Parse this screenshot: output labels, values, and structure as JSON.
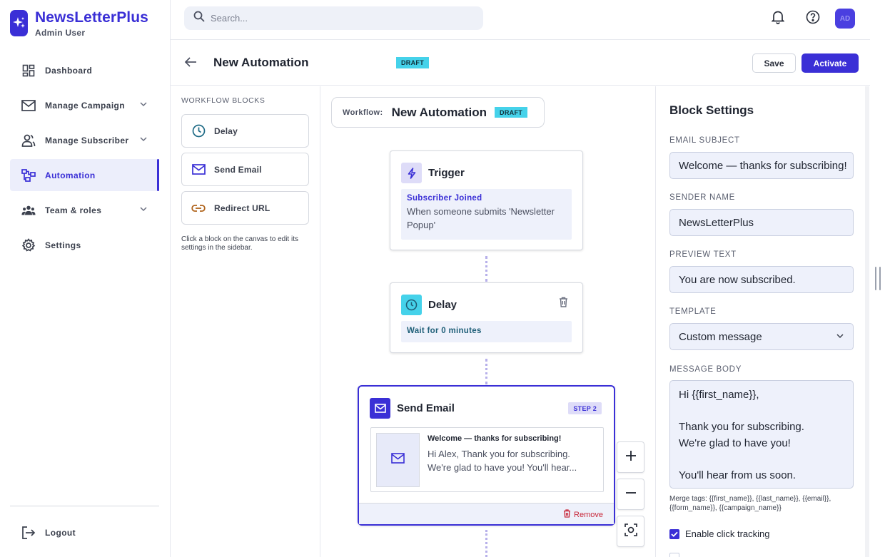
{
  "brand": {
    "name": "NewsLetterPlus",
    "user": "Admin User"
  },
  "nav": {
    "items": [
      {
        "label": "Dashboard",
        "icon": "dashboard-icon"
      },
      {
        "label": "Manage Campaign",
        "icon": "mail-icon",
        "expandable": true
      },
      {
        "label": "Manage Subscriber",
        "icon": "users-icon",
        "expandable": true
      },
      {
        "label": "Automation",
        "icon": "automation-icon",
        "active": true
      },
      {
        "label": "Team & roles",
        "icon": "team-icon",
        "expandable": true
      },
      {
        "label": "Settings",
        "icon": "gear-icon"
      }
    ],
    "logout": "Logout"
  },
  "topbar": {
    "search_placeholder": "Search...",
    "avatar": "AD"
  },
  "header": {
    "title": "New Automation",
    "status": "DRAFT",
    "save_label": "Save",
    "activate_label": "Activate"
  },
  "blocks": {
    "title": "WORKFLOW BLOCKS",
    "items": [
      {
        "label": "Delay",
        "icon": "clock-icon"
      },
      {
        "label": "Send Email",
        "icon": "mail-icon"
      },
      {
        "label": "Redirect URL",
        "icon": "link-icon"
      }
    ],
    "hint": "Click a block on the canvas to edit its settings in the sidebar."
  },
  "canvas": {
    "workflow_key": "Workflow:",
    "workflow_name": "New Automation",
    "workflow_status": "DRAFT",
    "trigger": {
      "title": "Trigger",
      "sub": "Subscriber Joined",
      "desc": "When someone submits 'Newsletter Popup'"
    },
    "delay": {
      "title": "Delay",
      "sub": "Wait for 0 minutes"
    },
    "email": {
      "title": "Send Email",
      "step": "STEP 2",
      "subject": "Welcome — thanks for subscribing!",
      "snippet_line1": "Hi Alex, Thank you for subscribing.",
      "snippet_line2": "We're glad to have you! You'll hear...",
      "remove": "Remove"
    }
  },
  "settings": {
    "title": "Block Settings",
    "email_subject_label": "EMAIL SUBJECT",
    "email_subject": "Welcome — thanks for subscribing!",
    "sender_name_label": "SENDER NAME",
    "sender_name": "NewsLetterPlus",
    "preview_text_label": "PREVIEW TEXT",
    "preview_text": "You are now subscribed.",
    "template_label": "TEMPLATE",
    "template": "Custom message",
    "message_body_label": "MESSAGE BODY",
    "message_body": [
      "Hi {{first_name}},",
      "",
      "Thank you for subscribing.",
      "We're glad to have you!",
      "",
      "You'll hear from us soon."
    ],
    "merge_tags": "Merge tags: {{first_name}}, {{last_name}}, {{email}}, {{form_name}}, {{campaign_name}}",
    "click_tracking_label": "Enable click tracking",
    "click_tracking": true
  },
  "colors": {
    "accent": "#3a2fd6",
    "draft": "#45d2ea",
    "danger": "#c8283a",
    "surface": "#eef1fb"
  }
}
